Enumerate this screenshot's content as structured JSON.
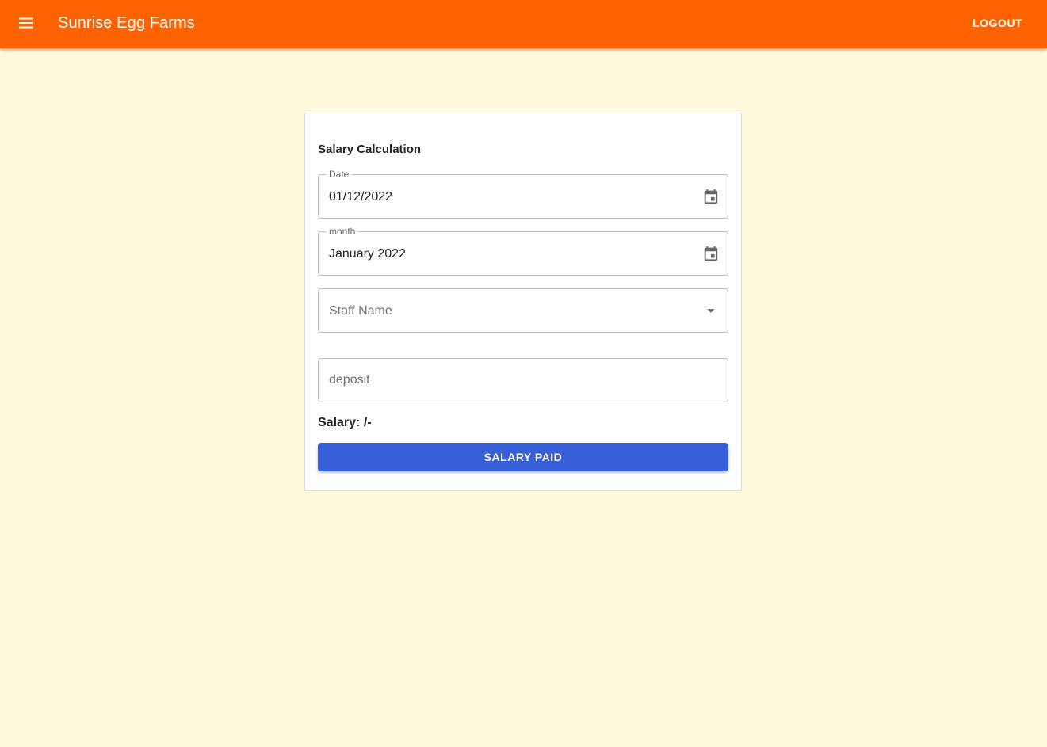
{
  "app": {
    "title": "Sunrise Egg Farms",
    "menu_icon": "hamburger-menu-icon",
    "logout_label": "LOGOUT",
    "bar_color": "#ff6200"
  },
  "form": {
    "title": "Salary Calculation",
    "date": {
      "label": "Date",
      "value": "01/12/2022",
      "icon": "calendar-icon"
    },
    "month": {
      "label": "month",
      "value": "January 2022",
      "icon": "calendar-icon"
    },
    "staff": {
      "placeholder": "Staff Name",
      "icon": "dropdown-arrow-icon"
    },
    "deposit": {
      "placeholder": "deposit",
      "value": ""
    },
    "salary_text": "Salary: /-",
    "submit_label": "SALARY PAID",
    "submit_color": "#3760d8"
  },
  "page": {
    "background": "#fffade"
  }
}
